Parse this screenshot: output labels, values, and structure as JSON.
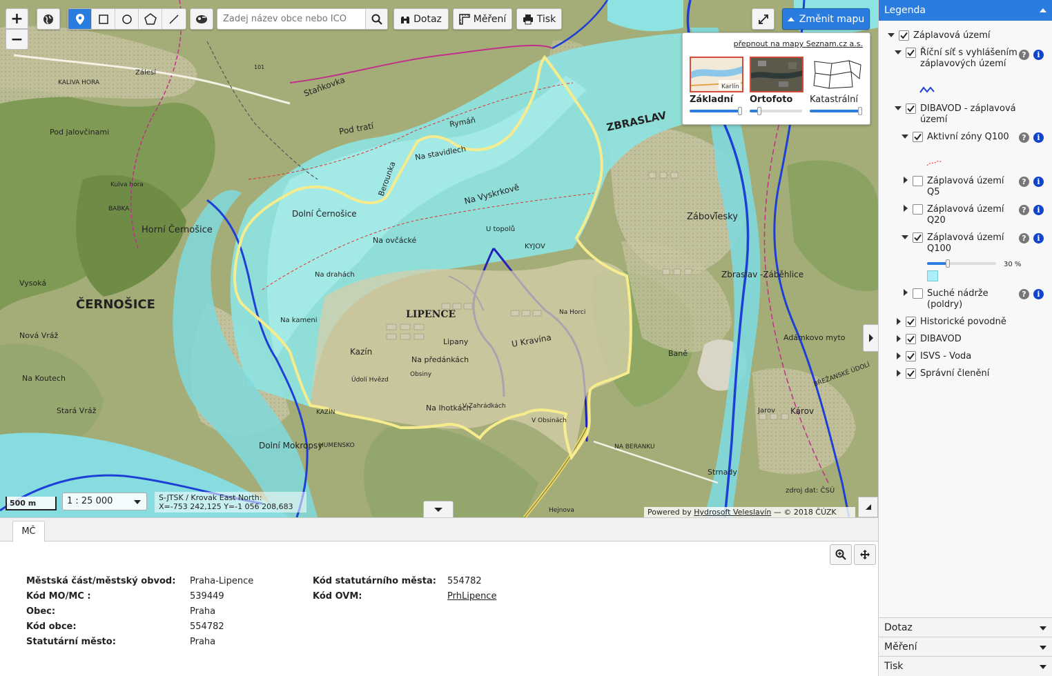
{
  "toolbar": {
    "zoom_in": "+",
    "zoom_out": "−",
    "search_placeholder": "Zadej název obce nebo IČO",
    "query_label": "Dotaz",
    "measure_label": "Měření",
    "print_label": "Tisk",
    "change_map_label": "Změnit mapu",
    "active_tool": "point-tool"
  },
  "basemaps": {
    "switch_link": "přepnout na mapy Seznam.cz a.s.",
    "items": [
      {
        "label": "Základní",
        "selected": true,
        "opacity": 1.0,
        "thumb_label": "Karlín"
      },
      {
        "label": "Ortofoto",
        "selected": true,
        "opacity": 0.2
      },
      {
        "label": "Katastrální",
        "selected": false,
        "opacity": 1.0
      }
    ]
  },
  "map": {
    "labels": {
      "zbraslav": "ZBRASLAV",
      "cernosice": "ČERNOŠICE",
      "horni_cernosice": "Horní Černošice",
      "dolni_cernosice": "Dolní Černošice",
      "lipence": "LIPENCE",
      "zabovresky": "Záboví̌esky",
      "zbraslav_zabehlice": "Zbraslav -Záběhlice",
      "kazin": "Kazín",
      "lipany": "Lipany",
      "u_kravina": "U Kravína",
      "na_vyskrkove": "Na Vyskrkově",
      "na_stavidlech": "Na stavidlech",
      "ryman": "Rymáň",
      "pod_trati": "Pod tratí",
      "stankovka": "Staňkovka",
      "nova_vraz": "Nová Vráž",
      "na_koutech": "Na Koutech",
      "stara_vraz": "Stará Vráž",
      "dolni_mokropsy": "Dolní Mokropsy",
      "karov": "Károv",
      "bane": "Baně",
      "strnady": "Strnady",
      "jarov": "Jarov",
      "kyjov": "KYJOV",
      "na_drahach": "Na drahách",
      "na_kameni": "Na kameni",
      "na_ovcacke": "Na ovčácké",
      "berounka": "Berounka",
      "vysoka": "Vysoká",
      "kaliva_hora": "KALIVA HORA",
      "zalesi": "Zálesí",
      "babka": "BABKA",
      "pod_jalovcinami": "Pod jalovčinami",
      "u_topolu": "U topolů",
      "kulva_hora": "Kulva hora",
      "na_predankach": "Na předánkách",
      "udoli_hvezd": "Údolí Hvězd",
      "na_lhotkach": "Na lhotkách",
      "v_obsinach": "V Obsinách",
      "v_zahradkach": "V Zahrádkách",
      "obsiny": "Obsiny",
      "na_horcich": "Na Horci",
      "kazin_caps": "KAZÍN",
      "humensko": "HUMENSKO",
      "na_beranku": "NA BERANKU",
      "adamkovo_myto": "Adámkovo myto",
      "brezanske_udoli": "BŘEŽANSKÉ ÚDOLÍ",
      "hajnova": "Hejnova",
      "road_101": "101"
    },
    "data_source": "zdroj dat: ČSÚ"
  },
  "status": {
    "scale_bar": "500 m",
    "scale_value": "1 : 25 000",
    "crs": "S-JTSK / Krovak East North:",
    "coords": "X=-753 242,125 Y=-1 056 208,683",
    "attribution_prefix": "Powered by ",
    "attribution_link": "Hydrosoft Veleslavín",
    "attribution_suffix": " — © 2018 ČÚZK"
  },
  "bottom": {
    "tab_label": "MČ",
    "left_rows": [
      {
        "key": "Městská část/městský obvod:",
        "value": "Praha-Lipence"
      },
      {
        "key": "Kód MO/MC :",
        "value": "539449"
      },
      {
        "key": "Obec:",
        "value": "Praha"
      },
      {
        "key": "Kód obce:",
        "value": "554782"
      },
      {
        "key": "Statutární město:",
        "value": "Praha"
      }
    ],
    "right_rows": [
      {
        "key": "Kód statutárního města:",
        "value": "554782"
      },
      {
        "key": "Kód OVM:",
        "value": "PrhLipence"
      }
    ]
  },
  "legend": {
    "title": "Legenda",
    "zaplavova_uzemi": "Záplavová území",
    "ricni_sit": "Říční síť s vyhlášením záplavových území",
    "dibavod_zu": "DIBAVOD - záplavová území",
    "aktivni_zony": "Aktivní zóny Q100",
    "zu_q5": "Záplavová území Q5",
    "zu_q20": "Záplavová území Q20",
    "zu_q100": "Záplavová území Q100",
    "opacity_value": "30 %",
    "suche_nadrze": "Suché nádrže (poldry)",
    "historicke_povodne": "Historické povodně",
    "dibavod": "DIBAVOD",
    "isvs_voda": "ISVS - Voda",
    "spravni_cleneni": "Správní členění",
    "q_label": "?",
    "i_label": "i",
    "colors": {
      "river": "#1d3fd6",
      "aktivni_zona": "#e03030",
      "q100_fill": "#aeeefa",
      "accent": "#2a7ddf"
    }
  },
  "accordion": {
    "query": "Dotaz",
    "measure": "Měření",
    "print": "Tisk"
  }
}
